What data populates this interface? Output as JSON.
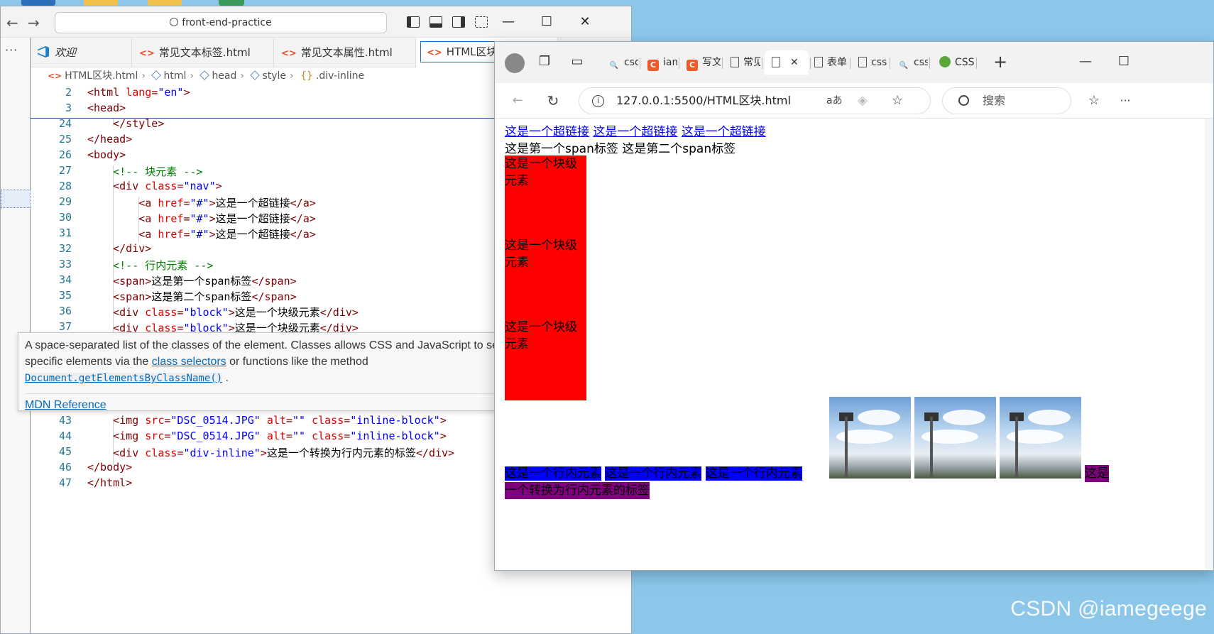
{
  "vscode": {
    "command_center": "front-end-practice",
    "tabs": [
      {
        "label": "欢迎"
      },
      {
        "label": "常见文本标签.html"
      },
      {
        "label": "常见文本属性.html"
      },
      {
        "label": "HTML区块.html"
      }
    ],
    "breadcrumb": [
      "HTML区块.html",
      "html",
      "head",
      "style",
      ".div-inline"
    ],
    "code_lines": [
      {
        "n": "2",
        "text": "<html lang=\"en\">"
      },
      {
        "n": "3",
        "text": "<head>"
      },
      {
        "n": "24",
        "text": "    </style>"
      },
      {
        "n": "25",
        "text": "</head>"
      },
      {
        "n": "26",
        "text": "<body>"
      },
      {
        "n": "27",
        "text": "    <!-- 块元素 -->"
      },
      {
        "n": "28",
        "text": "    <div class=\"nav\">"
      },
      {
        "n": "29",
        "text": "        <a href=\"#\">这是一个超链接</a>"
      },
      {
        "n": "30",
        "text": "        <a href=\"#\">这是一个超链接</a>"
      },
      {
        "n": "31",
        "text": "        <a href=\"#\">这是一个超链接</a>"
      },
      {
        "n": "32",
        "text": "    </div>"
      },
      {
        "n": "33",
        "text": "    <!-- 行内元素 -->"
      },
      {
        "n": "34",
        "text": "    <span>这是第一个span标签</span>"
      },
      {
        "n": "35",
        "text": "    <span>这是第二个span标签</span>"
      },
      {
        "n": "36",
        "text": "    <div class=\"block\">这是一个块级元素</div>"
      },
      {
        "n": "37",
        "text": "    <div class=\"block\">这是一个块级元素</div>"
      },
      {
        "n": "43",
        "text": "    <img src=\"DSC_0514.JPG\" alt=\"\" class=\"inline-block\">"
      },
      {
        "n": "44",
        "text": "    <img src=\"DSC_0514.JPG\" alt=\"\" class=\"inline-block\">"
      },
      {
        "n": "45",
        "text": "    <div class=\"div-inline\">这是一个转换为行内元素的标签</div>"
      },
      {
        "n": "46",
        "text": "</body>"
      },
      {
        "n": "47",
        "text": "</html>"
      }
    ],
    "hover": {
      "line1": "A space-separated list of the classes of the element. Classes allows CSS and JavaScript to select and access",
      "line2_pre": "specific elements via the ",
      "line2_link": "class selectors",
      "line2_post": " or functions like the method",
      "method": "Document.getElementsByClassName()",
      "method_suffix": ".",
      "mdn": "MDN Reference"
    }
  },
  "browser": {
    "tabs": [
      {
        "label": "csd",
        "icon": "search-favicon"
      },
      {
        "label": "iam",
        "icon": "c-favicon",
        "letter": "C"
      },
      {
        "label": "写文",
        "icon": "c-favicon",
        "letter": "C"
      },
      {
        "label": "常见",
        "icon": "page-favicon"
      },
      {
        "label": "",
        "icon": "page-favicon",
        "active": true
      },
      {
        "label": "表单",
        "icon": "page-favicon"
      },
      {
        "label": "css",
        "icon": "page-favicon"
      },
      {
        "label": "css",
        "icon": "search-favicon"
      },
      {
        "label": "CSS",
        "icon": "green-favicon"
      }
    ],
    "url": "127.0.0.1:5500/HTML区块.html",
    "search_placeholder": "搜索",
    "page": {
      "links": [
        "这是一个超链接",
        "这是一个超链接",
        "这是一个超链接"
      ],
      "spans": [
        "这是第一个span标签",
        "这是第二个span标签"
      ],
      "blocks": [
        "这是一个块级元素",
        "这是一个块级元素",
        "这是一个块级元素"
      ],
      "inline_divs": [
        "这是一个行内元素",
        "这是一个行内元素",
        "这是一个行内元素"
      ],
      "converted_line1": "这是",
      "converted_line2": "一个转换为行内元素的标签"
    }
  },
  "watermark": "CSDN @iamegeege",
  "colors": {
    "block": "#ff0000",
    "inline": "#0000ff",
    "converted": "#800080",
    "link": "#0000ee"
  }
}
